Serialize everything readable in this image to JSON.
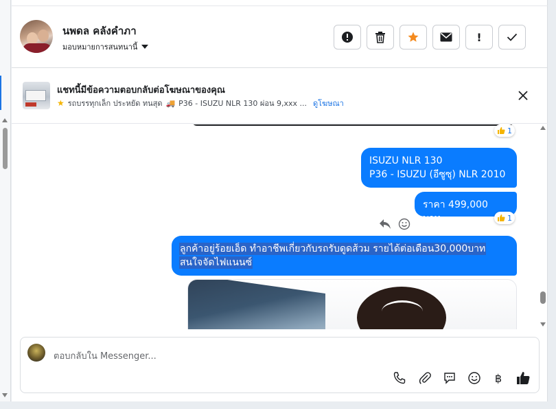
{
  "contact": {
    "name": "นพดล คลังคำภา",
    "assign_label": "มอบหมายการสนทนานี้"
  },
  "header_buttons": {
    "spam": "spam-icon",
    "delete": "trash-icon",
    "follow_up": "star-icon",
    "mark_unread": "envelope-icon",
    "important": "!",
    "done": "check-icon"
  },
  "ad": {
    "title": "แชทนี้มีข้อความตอบกลับต่อโฆษณาของคุณ",
    "description": "รถบรรทุกเล็ก ประหยัด ทนสุด",
    "detail": "P36 - ISUZU NLR 130 ผ่อน 9,xxx ...",
    "link": "ดูโฆษณา"
  },
  "messages": [
    {
      "lines": [
        "ISUZU NLR 130",
        "P36 - ISUZU (อีซูซุ) NLR 2010"
      ],
      "reaction_count": "1"
    },
    {
      "lines": [
        "ราคา 499,000 บาท"
      ],
      "reaction_count": "1"
    },
    {
      "lines": [
        "ลูกค้าอยู่ร้อยเอ็ด ทำอาชีพเกี่ยวกับรถรับดูดส้วม รายได้ต่อเดือน30,000บาท",
        "สนใจจัดไฟแนนซ์"
      ]
    }
  ],
  "top_reaction_count": "1",
  "composer": {
    "placeholder": "ตอบกลับใน Messenger...",
    "currency_symbol": "฿"
  },
  "colors": {
    "bubble": "#0a7cff",
    "accent": "#1b74e4",
    "star": "#f48a1e"
  }
}
